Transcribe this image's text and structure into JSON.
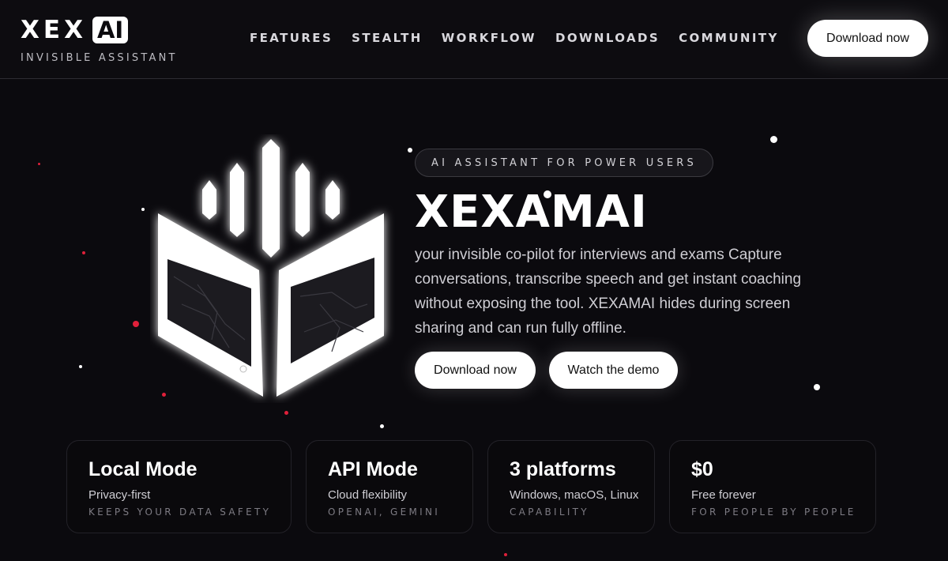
{
  "header": {
    "logo_text": "XEX",
    "logo_badge": "AI",
    "tagline": "INVISIBLE ASSISTANT",
    "nav": [
      "FEATURES",
      "STEALTH",
      "WORKFLOW",
      "DOWNLOADS",
      "COMMUNITY"
    ],
    "cta_label": "Download now"
  },
  "hero": {
    "badge": "AI ASSISTANT FOR POWER USERS",
    "title": "XEXAMAI",
    "description": "your invisible co-pilot for interviews and exams Capture conversations, transcribe speech and get instant coaching without exposing the tool. XEXAMAI hides during screen sharing and can run fully offline.",
    "primary_button": "Download now",
    "secondary_button": "Watch the demo"
  },
  "stats": [
    {
      "title": "Local Mode",
      "subtitle": "Privacy-first",
      "caption": "KEEPS YOUR DATA SAFETY"
    },
    {
      "title": "API Mode",
      "subtitle": "Cloud flexibility",
      "caption": "OPENAI, GEMINI"
    },
    {
      "title": "3 platforms",
      "subtitle": "Windows, macOS, Linux",
      "caption": "CAPABILITY"
    },
    {
      "title": "$0",
      "subtitle": "Free forever",
      "caption": "FOR PEOPLE BY PEOPLE"
    }
  ],
  "colors": {
    "background": "#0b0a0e",
    "accent_white": "#ffffff",
    "spark_red": "#e0203a"
  },
  "icons": {
    "emblem": "book-crown-emblem-icon"
  }
}
